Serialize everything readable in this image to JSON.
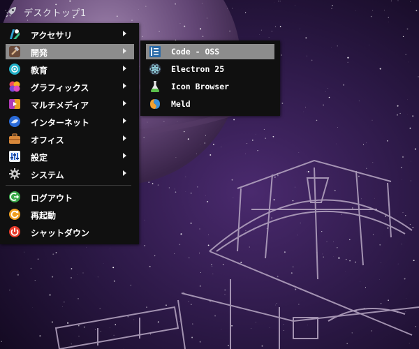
{
  "panel": {
    "title": "デスクトップ1",
    "rocket_icon": "rocket-icon"
  },
  "main_menu": {
    "items": [
      {
        "label": "アクセサリ",
        "icon": "accessories-icon",
        "has_submenu": true
      },
      {
        "label": "開発",
        "icon": "development-hammer-icon",
        "has_submenu": true,
        "active": true
      },
      {
        "label": "教育",
        "icon": "education-icon",
        "has_submenu": true
      },
      {
        "label": "グラフィックス",
        "icon": "graphics-icon",
        "has_submenu": true
      },
      {
        "label": "マルチメディア",
        "icon": "multimedia-icon",
        "has_submenu": true
      },
      {
        "label": "インターネット",
        "icon": "internet-globe-icon",
        "has_submenu": true
      },
      {
        "label": "オフィス",
        "icon": "office-briefcase-icon",
        "has_submenu": true
      },
      {
        "label": "設定",
        "icon": "settings-icon",
        "has_submenu": true
      },
      {
        "label": "システム",
        "icon": "system-gear-icon",
        "has_submenu": true
      },
      {
        "label": "ログアウト",
        "icon": "logout-icon",
        "has_submenu": false
      },
      {
        "label": "再起動",
        "icon": "restart-icon",
        "has_submenu": false
      },
      {
        "label": "シャットダウン",
        "icon": "shutdown-icon",
        "has_submenu": false
      }
    ]
  },
  "sub_menu": {
    "items": [
      {
        "label": "Code - OSS",
        "icon": "code-oss-icon",
        "active": true
      },
      {
        "label": "Electron 25",
        "icon": "electron-atom-icon"
      },
      {
        "label": "Icon Browser",
        "icon": "icon-browser-flask-icon"
      },
      {
        "label": "Meld",
        "icon": "meld-icon"
      }
    ]
  },
  "colors": {
    "menu_bg": "#101010",
    "highlight": "#8c8c8c",
    "text": "#ffffff",
    "wallpaper": "#2a1840"
  }
}
